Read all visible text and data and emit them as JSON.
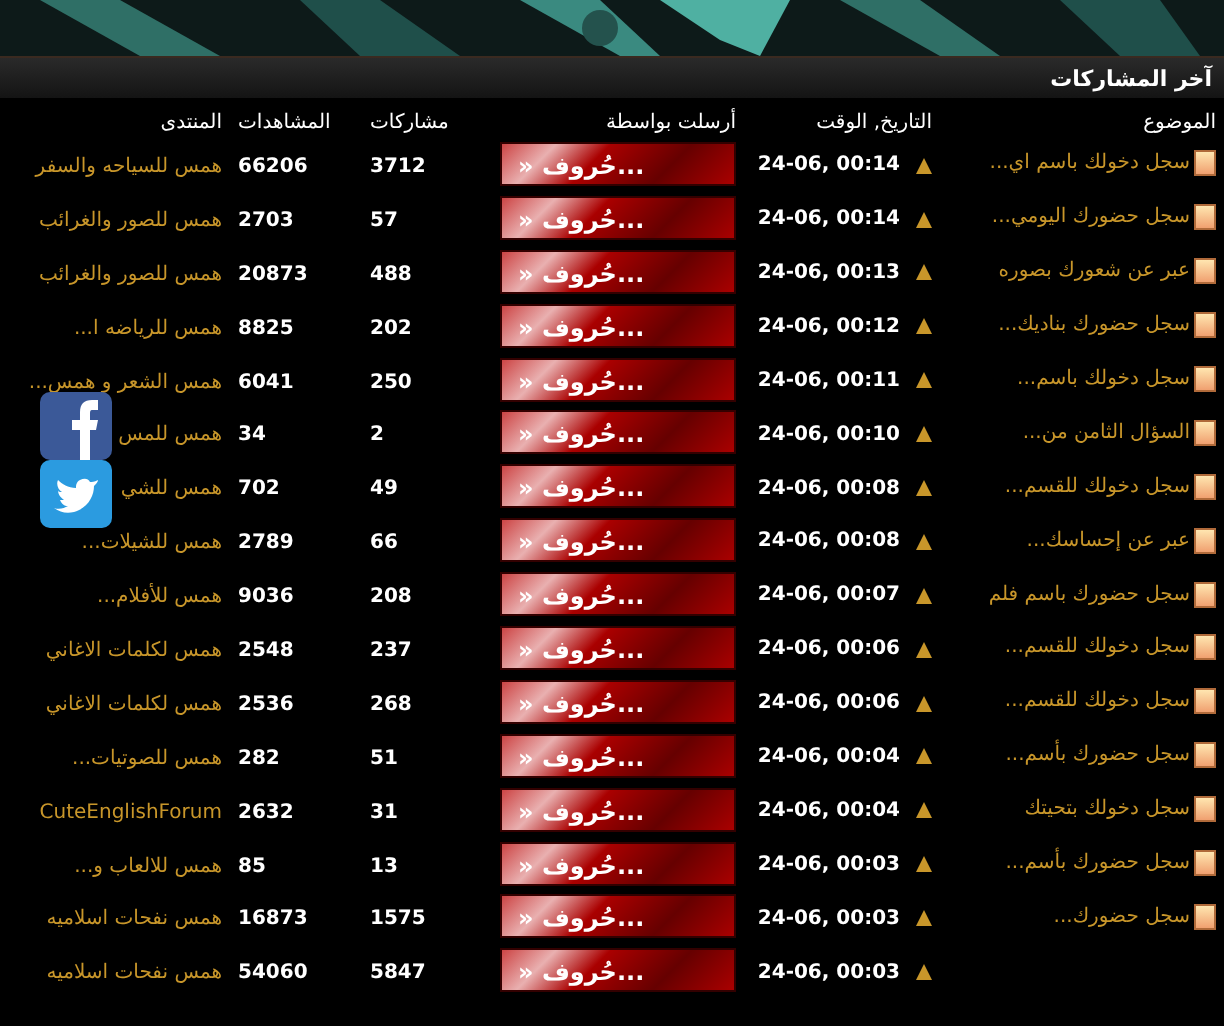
{
  "panel": {
    "title": "آخر المشاركات"
  },
  "columns": [
    "الموضوع",
    "التاريخ, الوقت",
    "أرسلت بواسطة",
    "مشاركات",
    "المشاهدات",
    "المنتدى"
  ],
  "rows": [
    {
      "topic": "سجل دخولك باسم اي...",
      "date": "24-06, 00:14",
      "sender": "» حُروف...",
      "posts": "3712",
      "views": "66206",
      "forum": "همس للسياحه والسفر"
    },
    {
      "topic": "سجل حضورك اليومي...",
      "date": "24-06, 00:14",
      "sender": "» حُروف...",
      "posts": "57",
      "views": "2703",
      "forum": "همس للصور والغرائب"
    },
    {
      "topic": "عبر عن شعورك بصوره",
      "date": "24-06, 00:13",
      "sender": "» حُروف...",
      "posts": "488",
      "views": "20873",
      "forum": "همس للصور والغرائب"
    },
    {
      "topic": "سجل حضورك بناديك...",
      "date": "24-06, 00:12",
      "sender": "» حُروف...",
      "posts": "202",
      "views": "8825",
      "forum": "همس للرياضه ا..."
    },
    {
      "topic": "سجل دخولك باسم...",
      "date": "24-06, 00:11",
      "sender": "» حُروف...",
      "posts": "250",
      "views": "6041",
      "forum": "همس الشعر و همس..."
    },
    {
      "topic": "السؤال الثامن من...",
      "date": "24-06, 00:10",
      "sender": "» حُروف...",
      "posts": "2",
      "views": "34",
      "forum": "همس للمس"
    },
    {
      "topic": "سجل دخولك للقسم...",
      "date": "24-06, 00:08",
      "sender": "» حُروف...",
      "posts": "49",
      "views": "702",
      "forum": "همس للشي"
    },
    {
      "topic": "عبر عن إحساسك...",
      "date": "24-06, 00:08",
      "sender": "» حُروف...",
      "posts": "66",
      "views": "2789",
      "forum": "همس للشيلات..."
    },
    {
      "topic": "سجل حضورك باسم فلم",
      "date": "24-06, 00:07",
      "sender": "» حُروف...",
      "posts": "208",
      "views": "9036",
      "forum": "همس للأفلام..."
    },
    {
      "topic": "سجل دخولك للقسم...",
      "date": "24-06, 00:06",
      "sender": "» حُروف...",
      "posts": "237",
      "views": "2548",
      "forum": "همس لكلمات الاغاني"
    },
    {
      "topic": "سجل دخولك للقسم...",
      "date": "24-06, 00:06",
      "sender": "» حُروف...",
      "posts": "268",
      "views": "2536",
      "forum": "همس لكلمات الاغاني"
    },
    {
      "topic": "سجل حضورك بأسم...",
      "date": "24-06, 00:04",
      "sender": "» حُروف...",
      "posts": "51",
      "views": "282",
      "forum": "همس للصوتيات..."
    },
    {
      "topic": "سجل دخولك بتحيتك",
      "date": "24-06, 00:04",
      "sender": "» حُروف...",
      "posts": "31",
      "views": "2632",
      "forum": "CuteEnglishForum"
    },
    {
      "topic": "سجل حضورك بأسم...",
      "date": "24-06, 00:03",
      "sender": "» حُروف...",
      "posts": "13",
      "views": "85",
      "forum": "همس للالعاب و..."
    },
    {
      "topic": "سجل حضورك...",
      "date": "24-06, 00:03",
      "sender": "» حُروف...",
      "posts": "1575",
      "views": "16873",
      "forum": "همس نفحات اسلاميه"
    },
    {
      "date": "24-06, 00:03",
      "sender": "» حُروف...",
      "posts": "5847",
      "views": "54060",
      "forum": "همس نفحات اسلاميه"
    }
  ]
}
